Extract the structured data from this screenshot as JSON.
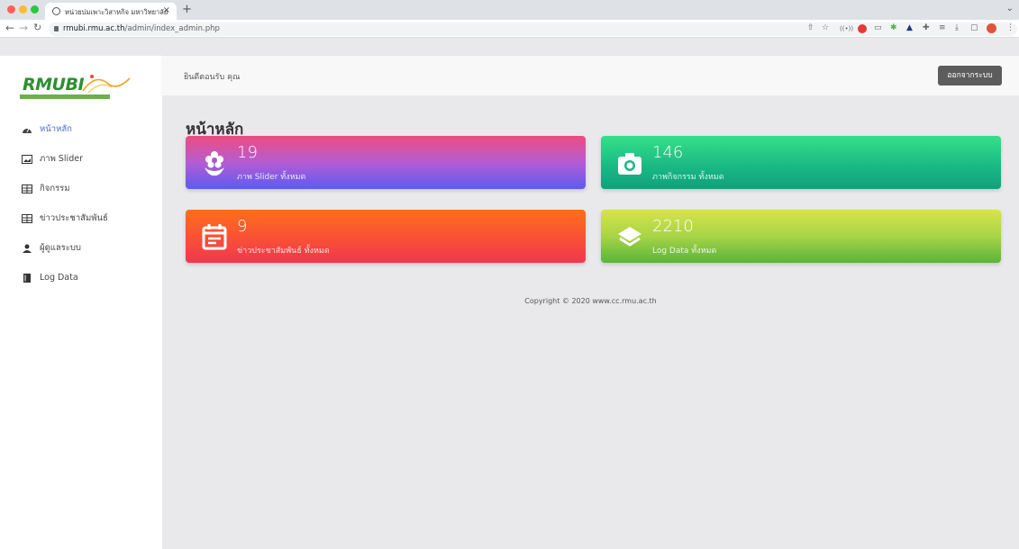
{
  "browser": {
    "tab_title": "หน่วยบ่มเพาะวิสาหกิจ มหาวิทยาลัย",
    "tab_close": "×",
    "new_tab": "+",
    "url_host": "rmubi.rmu.ac.th",
    "url_path": "/admin/index_admin.php"
  },
  "logo": {
    "text": "RMUBI"
  },
  "topbar": {
    "welcome": "ยินดีตอนรับ คุณ",
    "logout_label": "ออกจากระบบ"
  },
  "sidebar": {
    "items": [
      {
        "label": "หน้าหลัก",
        "icon": "dashboard-icon",
        "active": true
      },
      {
        "label": "ภาพ Slider",
        "icon": "image-icon",
        "active": false
      },
      {
        "label": "กิจกรรม",
        "icon": "table-icon",
        "active": false
      },
      {
        "label": "ข่าวประชาสัมพันธ์",
        "icon": "table-icon",
        "active": false
      },
      {
        "label": "ผู้ดูแลระบบ",
        "icon": "user-icon",
        "active": false
      },
      {
        "label": "Log Data",
        "icon": "book-icon",
        "active": false
      }
    ]
  },
  "main": {
    "title": "หน้าหลัก",
    "cards": [
      {
        "count": "19",
        "label": "ภาพ Slider ทั้งหมด",
        "icon": "flower-icon"
      },
      {
        "count": "146",
        "label": "ภาพกิจกรรม ทั้งหมด",
        "icon": "camera-icon"
      },
      {
        "count": "9",
        "label": "ข่าวประชาสัมพันธ์ ทั้งหมด",
        "icon": "calendar-icon"
      },
      {
        "count": "2210",
        "label": "Log Data ทั้งหมด",
        "icon": "layers-icon"
      }
    ],
    "footer": "Copyright © 2020 www.cc.rmu.ac.th"
  },
  "colors": {
    "active_nav": "#4a6cd4",
    "logout_bg": "#5c5c5c",
    "background": "#e9e9ec"
  }
}
